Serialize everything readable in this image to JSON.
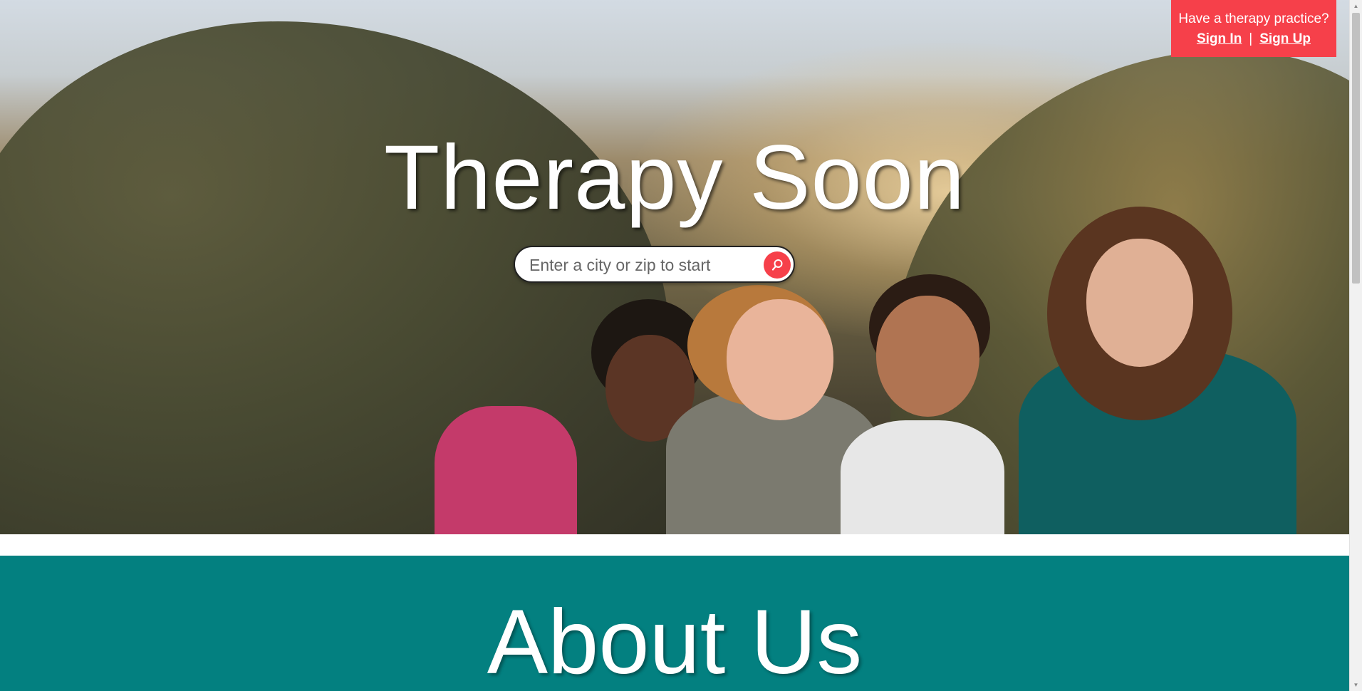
{
  "practice": {
    "question": "Have a therapy practice?",
    "sign_in": "Sign In",
    "separator": "|",
    "sign_up": "Sign Up"
  },
  "hero": {
    "title": "Therapy Soon",
    "image_icon": "hero-photo-image"
  },
  "search": {
    "placeholder": "Enter a city or zip to start",
    "value": "",
    "button_icon": "search-icon"
  },
  "about": {
    "title": "About Us"
  },
  "colors": {
    "accent": "#f6404a",
    "teal": "#038080",
    "white": "#ffffff"
  }
}
